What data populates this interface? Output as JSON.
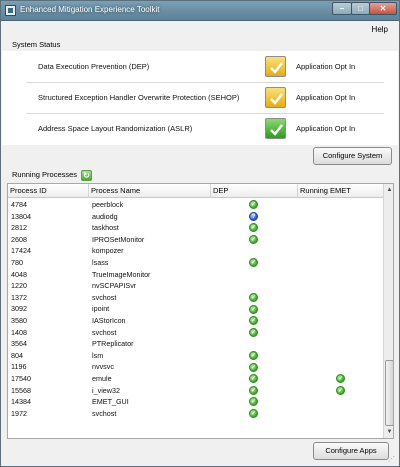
{
  "window": {
    "title": "Enhanced Mitigation Experience Toolkit"
  },
  "menu": {
    "help": "Help"
  },
  "system_status": {
    "header": "System Status",
    "rows": [
      {
        "label": "Data Execution Prevention (DEP)",
        "status": "warning",
        "value": "Application Opt In"
      },
      {
        "label": "Structured Exception Handler Overwrite Protection (SEHOP)",
        "status": "warning",
        "value": "Application Opt In"
      },
      {
        "label": "Address Space Layout Randomization (ASLR)",
        "status": "ok",
        "value": "Application Opt In"
      }
    ],
    "configure_button": "Configure System"
  },
  "running_processes": {
    "header": "Running Processes",
    "columns": [
      "Process ID",
      "Process Name",
      "DEP",
      "Running EMET"
    ],
    "rows": [
      {
        "pid": "4784",
        "name": "peerblock",
        "dep": "green",
        "emet": ""
      },
      {
        "pid": "13804",
        "name": "audiodg",
        "dep": "blue",
        "emet": ""
      },
      {
        "pid": "2812",
        "name": "taskhost",
        "dep": "green",
        "emet": ""
      },
      {
        "pid": "2608",
        "name": "IPROSetMonitor",
        "dep": "green",
        "emet": ""
      },
      {
        "pid": "17424",
        "name": "kompozer",
        "dep": "",
        "emet": ""
      },
      {
        "pid": "780",
        "name": "lsass",
        "dep": "green",
        "emet": ""
      },
      {
        "pid": "4048",
        "name": "TrueImageMonitor",
        "dep": "",
        "emet": ""
      },
      {
        "pid": "1220",
        "name": "nvSCPAPISvr",
        "dep": "",
        "emet": ""
      },
      {
        "pid": "1372",
        "name": "svchost",
        "dep": "green",
        "emet": ""
      },
      {
        "pid": "3092",
        "name": "ipoint",
        "dep": "green",
        "emet": ""
      },
      {
        "pid": "3580",
        "name": "IAStorIcon",
        "dep": "green",
        "emet": ""
      },
      {
        "pid": "1408",
        "name": "svchost",
        "dep": "green",
        "emet": ""
      },
      {
        "pid": "3564",
        "name": "PTReplicator",
        "dep": "",
        "emet": ""
      },
      {
        "pid": "804",
        "name": "lsm",
        "dep": "green",
        "emet": ""
      },
      {
        "pid": "1196",
        "name": "nvvsvc",
        "dep": "green",
        "emet": ""
      },
      {
        "pid": "17540",
        "name": "emule",
        "dep": "green",
        "emet": "green"
      },
      {
        "pid": "15568",
        "name": "i_view32",
        "dep": "green",
        "emet": "green"
      },
      {
        "pid": "14384",
        "name": "EMET_GUI",
        "dep": "green",
        "emet": ""
      },
      {
        "pid": "1972",
        "name": "svchost",
        "dep": "green",
        "emet": ""
      }
    ],
    "configure_button": "Configure Apps"
  },
  "colors": {
    "titlebar": "#6a8da3",
    "ok": "#3ea72a",
    "warning": "#e4ac17",
    "info": "#2456c9"
  }
}
